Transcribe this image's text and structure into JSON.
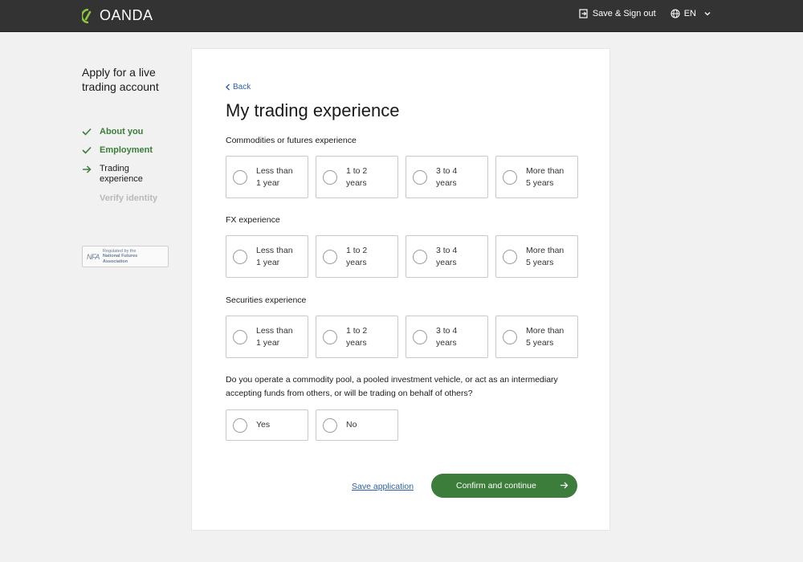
{
  "header": {
    "logo_text": "OANDA",
    "save_signout_label": "Save & Sign out",
    "language_label": "EN"
  },
  "sidebar": {
    "title": "Apply for a live trading account",
    "steps": [
      {
        "label": "About you",
        "state": "done"
      },
      {
        "label": "Employment",
        "state": "done"
      },
      {
        "label": "Trading experience",
        "state": "current"
      },
      {
        "label": "Verify identity",
        "state": "future"
      }
    ],
    "badge": {
      "mark": "NFA",
      "line1": "Regulated by the",
      "line2": "National Futures",
      "line3": "Association"
    }
  },
  "main": {
    "back_label": "Back",
    "title": "My trading experience",
    "questions": [
      {
        "label": "Commodities or futures experience",
        "options": [
          {
            "line1": "Less than",
            "line2": "1 year"
          },
          {
            "line1": "1 to 2",
            "line2": "years"
          },
          {
            "line1": "3 to 4",
            "line2": "years"
          },
          {
            "line1": "More than",
            "line2": "5 years"
          }
        ]
      },
      {
        "label": "FX experience",
        "options": [
          {
            "line1": "Less than",
            "line2": "1 year"
          },
          {
            "line1": "1 to 2",
            "line2": "years"
          },
          {
            "line1": "3 to 4",
            "line2": "years"
          },
          {
            "line1": "More than",
            "line2": "5 years"
          }
        ]
      },
      {
        "label": "Securities experience",
        "options": [
          {
            "line1": "Less than",
            "line2": "1 year"
          },
          {
            "line1": "1 to 2",
            "line2": "years"
          },
          {
            "line1": "3 to 4",
            "line2": "years"
          },
          {
            "line1": "More than",
            "line2": "5 years"
          }
        ]
      }
    ],
    "pool_question": {
      "line1": "Do you operate a commodity pool, a pooled investment vehicle, or act as an intermediary",
      "line2": "accepting funds from others, or will be trading on behalf of others?",
      "options": [
        "Yes",
        "No"
      ]
    },
    "save_label": "Save application",
    "confirm_label": "Confirm and continue"
  },
  "colors": {
    "header_bg": "#333333",
    "accent_green": "#3c7d3c",
    "link_blue": "#2d5fa8",
    "logo_green": "#8cc63f"
  }
}
